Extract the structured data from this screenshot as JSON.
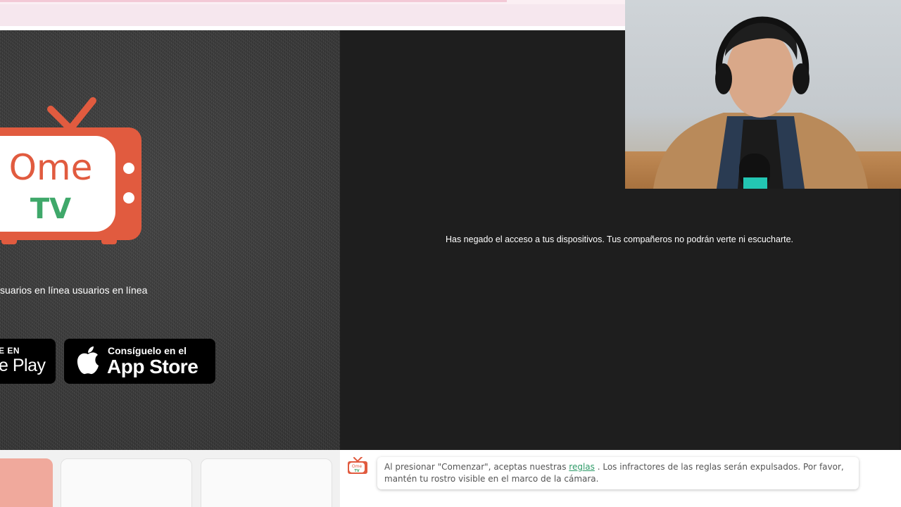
{
  "logo": {
    "word1": "Ome",
    "word2": "TV"
  },
  "online_users_text": "suarios en línea usuarios en línea",
  "google_play": {
    "small_label": "E EN",
    "big_label": "e Play"
  },
  "app_store": {
    "small_label": "Consíguelo en el",
    "big_label": "App Store"
  },
  "stage": {
    "message": "Has negado el acceso a tus dispositivos. Tus compañeros no podrán verte ni escucharte."
  },
  "rules": {
    "icon_word1": "Ome",
    "icon_word2": "TV",
    "text_before": "Al presionar \"Comenzar\", aceptas nuestras ",
    "link": "reglas",
    "text_after": " . Los infractores de las reglas serán expulsados. Por favor, mantén tu rostro visible en el marco de la cámara."
  },
  "colors": {
    "brand_orange": "#e15b3f",
    "brand_green": "#3fa86a",
    "link_green": "#2e9b68"
  },
  "icons": [
    "ometv-logo-icon",
    "apple-icon",
    "ometv-small-icon"
  ]
}
